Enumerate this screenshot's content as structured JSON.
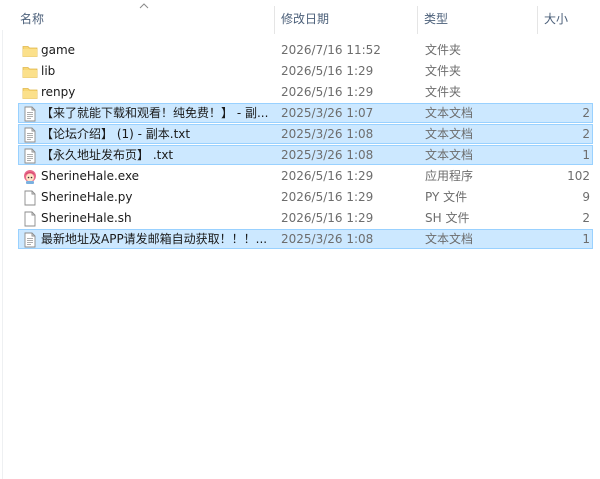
{
  "columns": {
    "name": "名称",
    "date": "修改日期",
    "type": "类型",
    "size": "大小"
  },
  "files": [
    {
      "name": "game",
      "date": "2026/7/16 11:52",
      "type": "文件夹",
      "size": "",
      "icon": "folder-icon",
      "selected": false
    },
    {
      "name": "lib",
      "date": "2026/5/16 1:29",
      "type": "文件夹",
      "size": "",
      "icon": "folder-icon",
      "selected": false
    },
    {
      "name": "renpy",
      "date": "2026/5/16 1:29",
      "type": "文件夹",
      "size": "",
      "icon": "folder-icon",
      "selected": false
    },
    {
      "name": "【来了就能下载和观看！纯免费！】 - 副...",
      "date": "2025/3/26 1:07",
      "type": "文本文档",
      "size": "2",
      "icon": "text-file-icon",
      "selected": true
    },
    {
      "name": "【论坛介绍】 (1) - 副本.txt",
      "date": "2025/3/26 1:08",
      "type": "文本文档",
      "size": "2",
      "icon": "text-file-icon",
      "selected": true
    },
    {
      "name": "【永久地址发布页】 .txt",
      "date": "2025/3/26 1:08",
      "type": "文本文档",
      "size": "1",
      "icon": "text-file-icon",
      "selected": true
    },
    {
      "name": "SherineHale.exe",
      "date": "2026/5/16 1:29",
      "type": "应用程序",
      "size": "102",
      "icon": "app-icon",
      "selected": false
    },
    {
      "name": "SherineHale.py",
      "date": "2026/5/16 1:29",
      "type": "PY 文件",
      "size": "9",
      "icon": "file-icon",
      "selected": false
    },
    {
      "name": "SherineHale.sh",
      "date": "2026/5/16 1:29",
      "type": "SH 文件",
      "size": "2",
      "icon": "file-icon",
      "selected": false
    },
    {
      "name": "最新地址及APP请发邮箱自动获取！！！...",
      "date": "2025/3/26 1:08",
      "type": "文本文档",
      "size": "1",
      "icon": "text-file-icon",
      "selected": true
    }
  ],
  "colors": {
    "selection_bg": "#cce8ff",
    "selection_border": "#99d1ff",
    "folder": "#f8d775",
    "header_text": "#4c607a"
  }
}
